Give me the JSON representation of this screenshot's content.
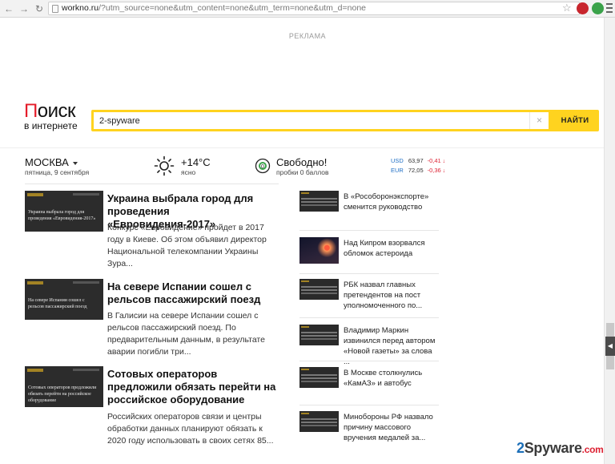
{
  "browser": {
    "url_host": "workno.ru",
    "url_path": "/?utm_source=none&utm_content=none&utm_term=none&utm_d=none"
  },
  "ad": {
    "label": "РЕКЛАМА"
  },
  "logo": {
    "title_first": "П",
    "title_rest": "оиск",
    "subtitle": "в интернете"
  },
  "search": {
    "query": "2-spyware",
    "clear_label": "×",
    "button_label": "НАЙТИ"
  },
  "location": {
    "city": "МОСКВА",
    "date": "пятница, 9 сентября"
  },
  "weather": {
    "temperature": "+14°С",
    "condition": "ясно"
  },
  "traffic": {
    "status": "Свободно!",
    "score": "пробки 0 баллов"
  },
  "rates": [
    {
      "currency": "USD",
      "value": "63,97",
      "change": "-0,41"
    },
    {
      "currency": "EUR",
      "value": "72,05",
      "change": "-0,36"
    }
  ],
  "main_news": [
    {
      "thumb_text": "Украина выбрала город для проведения «Евровидения-2017»",
      "title": "Украина выбрала город для проведения «Евровидения-2017»",
      "snippet": "Конкурс «Евровидение» пройдет в 2017 году в Киеве. Об этом объявил директор Национальной телекомпании Украины Зура..."
    },
    {
      "thumb_text": "На севере Испании сошел с рельсов пассажирский поезд",
      "title": "На севере Испании сошел с рельсов пассажирский поезд",
      "snippet": "В Галисии на севере Испании сошел с рельсов пассажирский поезд. По предварительным данным, в результате аварии погибли три..."
    },
    {
      "thumb_text": "Сотовых операторов предложили обязать перейти на российское оборудование",
      "title": "Сотовых операторов предложили обязать перейти на российское оборудование",
      "snippet": "Российских операторов связи и центры обработки данных планируют обязать к 2020 году использовать в своих сетях 85..."
    }
  ],
  "side_news": [
    {
      "text": "В «Рособоронэкспорте» сменится руководство"
    },
    {
      "text": "Над Кипром взорвался обломок астероида"
    },
    {
      "text": "РБК назвал главных претендентов на пост уполномоченного по..."
    },
    {
      "text": "Владимир Маркин извинился перед автором «Новой газеты» за слова ..."
    },
    {
      "text": "В Москве столкнулись «КамАЗ» и автобус"
    },
    {
      "text": "Минобороны РФ назвало причину массового вручения медалей за..."
    }
  ],
  "watermark": {
    "prefix": "2",
    "brand": "Spyware",
    "suffix": ".com"
  },
  "icons": {
    "back": "arrow-left-icon",
    "forward": "arrow-right-icon",
    "reload": "reload-icon",
    "weather": "sun-icon",
    "traffic": "traffic-light-icon"
  },
  "colors": {
    "brand_red": "#e41c2a",
    "search_yellow": "#ffd31f",
    "rate_blue": "#1f6fc5"
  }
}
